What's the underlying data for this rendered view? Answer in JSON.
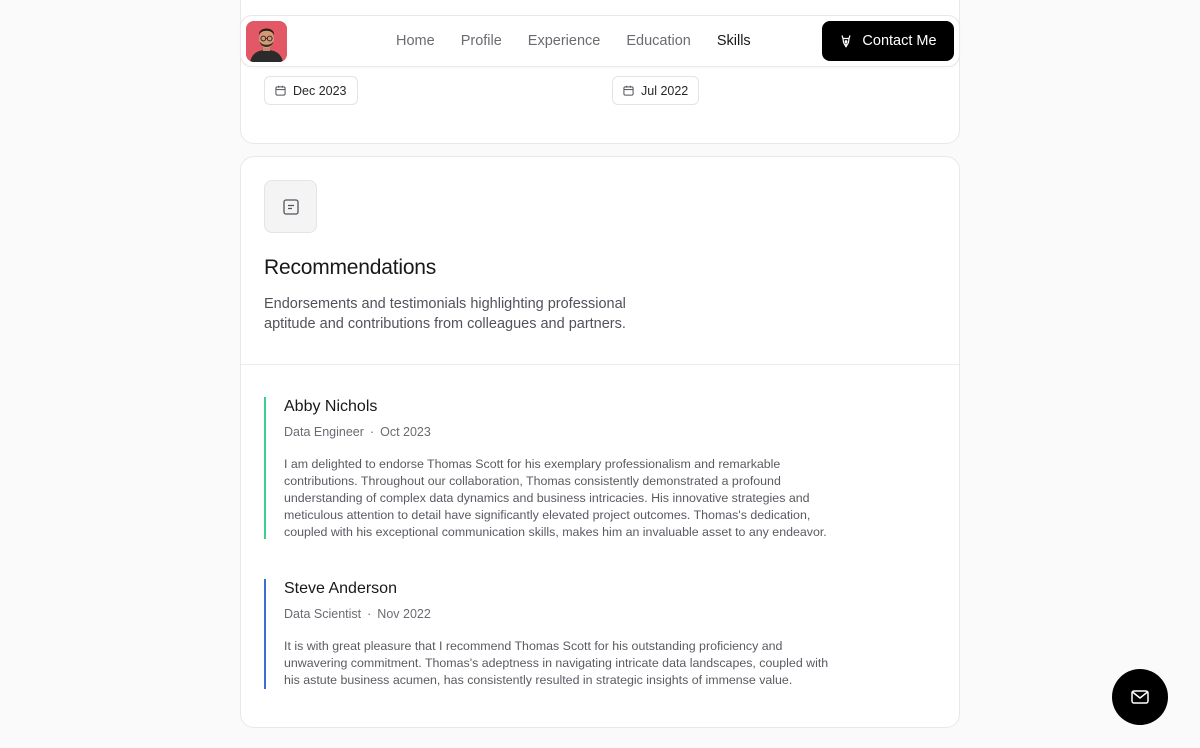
{
  "experience_dates": [
    "Dec 2023",
    "Jul 2022"
  ],
  "nav": {
    "links": [
      "Home",
      "Profile",
      "Experience",
      "Education",
      "Skills"
    ],
    "active": "Skills",
    "contact_label": "Contact Me"
  },
  "recommendations": {
    "title": "Recommendations",
    "description": "Endorsements and testimonials highlighting professional aptitude and contributions from colleagues and partners.",
    "items": [
      {
        "name": "Abby Nichols",
        "role": "Data Engineer",
        "date": "Oct 2023",
        "text": "I am delighted to endorse Thomas Scott for his exemplary professionalism and remarkable contributions. Throughout our collaboration, Thomas consistently demonstrated a profound understanding of complex data dynamics and business intricacies. His innovative strategies and meticulous attention to detail have significantly elevated project outcomes. Thomas's dedication, coupled with his exceptional communication skills, makes him an invaluable asset to any endeavor.",
        "accent": "#3ccf91"
      },
      {
        "name": "Steve Anderson",
        "role": "Data Scientist",
        "date": "Nov 2022",
        "text": "It is with great pleasure that I recommend Thomas Scott for his outstanding proficiency and unwavering commitment. Thomas's adeptness in navigating intricate data landscapes, coupled with his astute business acumen, has consistently resulted in strategic insights of immense value.",
        "accent": "#3b6fd4"
      }
    ]
  },
  "icons": {
    "calendar": "calendar-icon",
    "contact": "pen-nib-icon",
    "section": "document-icon",
    "fab": "mail-icon"
  }
}
